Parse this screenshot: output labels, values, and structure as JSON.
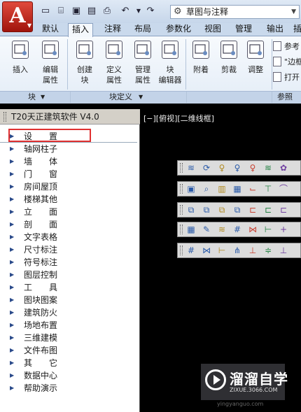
{
  "app": {
    "logo_letter": "A",
    "workspace": "草图与注释"
  },
  "quick_access": [
    {
      "icon": "new-icon",
      "glyph": "▭"
    },
    {
      "icon": "open-icon",
      "glyph": "⌸"
    },
    {
      "icon": "save-icon",
      "glyph": "▣"
    },
    {
      "icon": "saveas-icon",
      "glyph": "▤"
    },
    {
      "icon": "print-icon",
      "glyph": "⎙"
    },
    {
      "icon": "undo-icon",
      "glyph": "↶"
    },
    {
      "icon": "redo-icon",
      "glyph": "↷"
    }
  ],
  "tabs": [
    "默认",
    "插入",
    "注释",
    "布局",
    "参数化",
    "视图",
    "管理",
    "输出",
    "插"
  ],
  "active_tab": "插入",
  "ribbon": {
    "buttons": [
      "插入",
      "编辑\n属性",
      "创建\n块",
      "定义\n属性",
      "管理\n属性",
      "块\n编辑器",
      "附着",
      "剪裁",
      "调整"
    ],
    "side_items": [
      "参考",
      "\"边框",
      "打开"
    ],
    "panels": [
      "块",
      "块定义",
      "参照"
    ]
  },
  "palette": {
    "title": "T20天正建筑软件 V4.0",
    "items": [
      "设　　置",
      "轴网柱子",
      "墙　　体",
      "门　　窗",
      "房间屋顶",
      "楼梯其他",
      "立　　面",
      "剖　　面",
      "文字表格",
      "尺寸标注",
      "符号标注",
      "图层控制",
      "工　　具",
      "图块图案",
      "建筑防火",
      "场地布置",
      "三维建模",
      "文件布图",
      "其　　它",
      "数据中心",
      "帮助演示"
    ],
    "selected": "设　　置"
  },
  "viewport": {
    "label": "[−][俯视][二维线框]"
  },
  "toolbars": [
    [
      "layers-icon",
      "refresh-icon",
      "bulb-off-icon",
      "bulb-icon",
      "bulb-on-icon",
      "stack-icon",
      "flower-icon"
    ],
    [
      "picture-icon",
      "zoom-page-icon",
      "columns-icon",
      "table-icon",
      "pipe-icon",
      "valve-icon",
      "arc-icon"
    ],
    [
      "copy-icon",
      "copy2-icon",
      "copy3-icon",
      "copy4-icon",
      "frame-icon",
      "frame2-icon",
      "frame3-icon"
    ],
    [
      "ruler-icon",
      "edit-doc-icon",
      "layers2-icon",
      "grid-icon",
      "nodes-icon",
      "node-line-icon",
      "cross-icon"
    ],
    [
      "grid2-icon",
      "nodes2-icon",
      "node-line2-icon",
      "leaf-icon",
      "measure-icon",
      "double-line-icon",
      "gauge-icon"
    ]
  ],
  "watermark": {
    "text": "溜溜自学",
    "sub": "ZIXUE.3066.COM",
    "url": "yingyanguo.com"
  }
}
